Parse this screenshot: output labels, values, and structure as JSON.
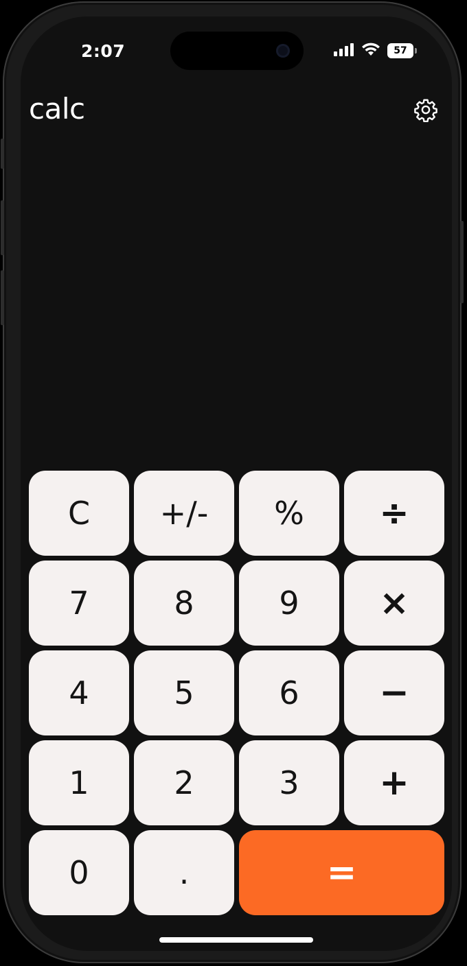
{
  "status_bar": {
    "time": "2:07",
    "battery": "57",
    "icons": [
      "signal-icon",
      "wifi-icon",
      "battery-icon"
    ]
  },
  "header": {
    "title": "calc",
    "settings_icon": "gear-icon"
  },
  "keypad": {
    "rows": [
      [
        "C",
        "+/-",
        "%",
        "÷"
      ],
      [
        "7",
        "8",
        "9",
        "×"
      ],
      [
        "4",
        "5",
        "6",
        "−"
      ],
      [
        "1",
        "2",
        "3",
        "+"
      ],
      [
        "0",
        ".",
        "="
      ]
    ]
  },
  "colors": {
    "background": "#111111",
    "key": "#f5f1f0",
    "key_text": "#141414",
    "accent": "#fc6a24"
  }
}
